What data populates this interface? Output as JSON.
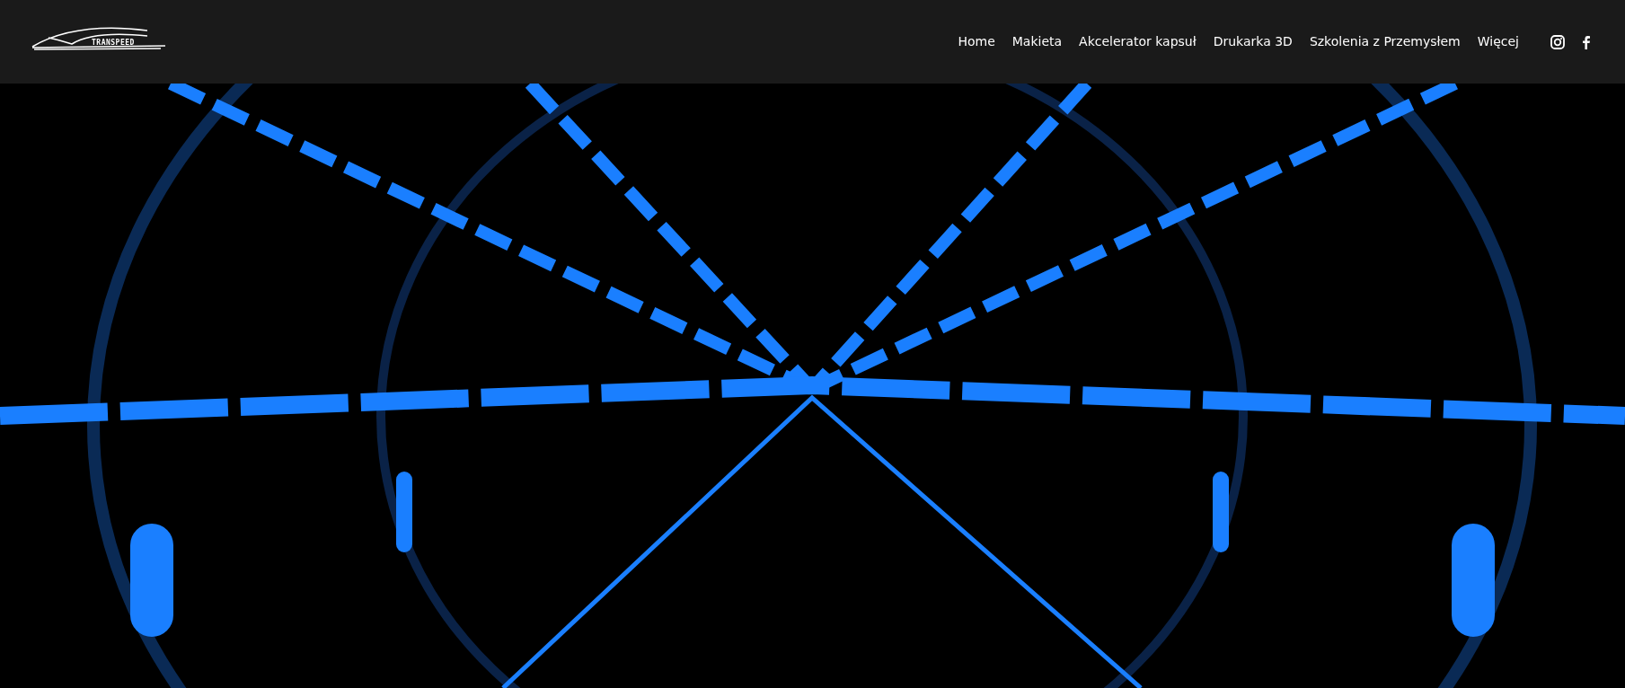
{
  "logo": {
    "text": "TRANSPEED"
  },
  "nav": [
    {
      "label": "Home"
    },
    {
      "label": "Makieta"
    },
    {
      "label": "Akcelerator kapsuł"
    },
    {
      "label": "Drukarka 3D"
    },
    {
      "label": "Szkolenia z Przemysłem"
    },
    {
      "label": "Więcej"
    }
  ],
  "social": [
    {
      "kind": "instagram"
    },
    {
      "kind": "facebook"
    }
  ]
}
